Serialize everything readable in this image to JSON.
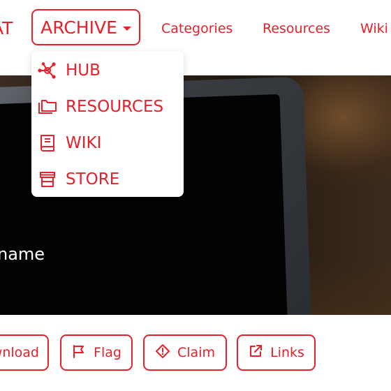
{
  "nav": {
    "left_fragment": "AT",
    "archive_label": "ARCHIVE",
    "links": [
      "Categories",
      "Resources",
      "Wiki"
    ]
  },
  "dropdown": {
    "items": [
      {
        "label": "HUB",
        "icon": "hub-network-icon"
      },
      {
        "label": "RESOURCES",
        "icon": "folders-icon"
      },
      {
        "label": "WIKI",
        "icon": "book-icon"
      },
      {
        "label": "STORE",
        "icon": "store-icon"
      }
    ]
  },
  "hero": {
    "title_fragment": "name"
  },
  "actions": {
    "download_fragment": "wnload",
    "flag_label": "Flag",
    "claim_label": "Claim",
    "links_label": "Links"
  },
  "colors": {
    "accent": "#e8202a",
    "background": "#ffffff",
    "hero_dark": "#21180f"
  }
}
